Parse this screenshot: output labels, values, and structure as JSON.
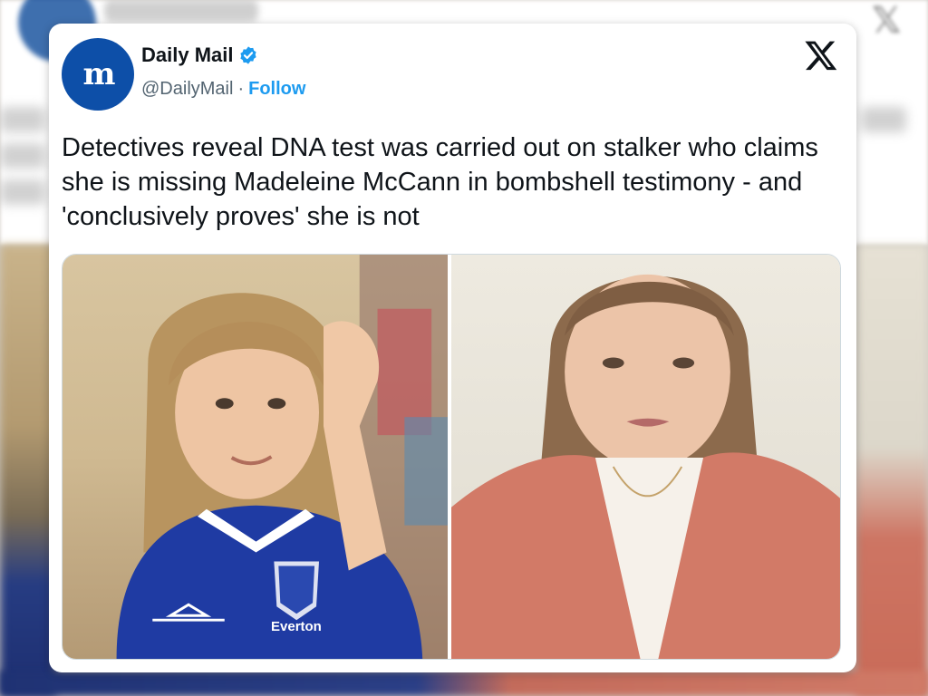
{
  "tweet": {
    "account_name": "Daily Mail",
    "avatar_text": "m",
    "handle": "@DailyMail",
    "separator": "·",
    "follow_label": "Follow",
    "text": "Detectives reveal DNA test was carried out on stalker who claims she is missing Madeleine McCann in bombshell testimony - and 'conclusively proves' she is not",
    "photo_left_shirt_text": "Everton"
  },
  "colors": {
    "brand_blue": "#0d4fa8",
    "follow_blue": "#1d9bf0",
    "verified_blue": "#1d9bf0",
    "text_primary": "#0f1419",
    "text_secondary": "#536471"
  },
  "icons": {
    "verified": "verified-badge-icon",
    "x_logo": "x-logo-icon"
  }
}
